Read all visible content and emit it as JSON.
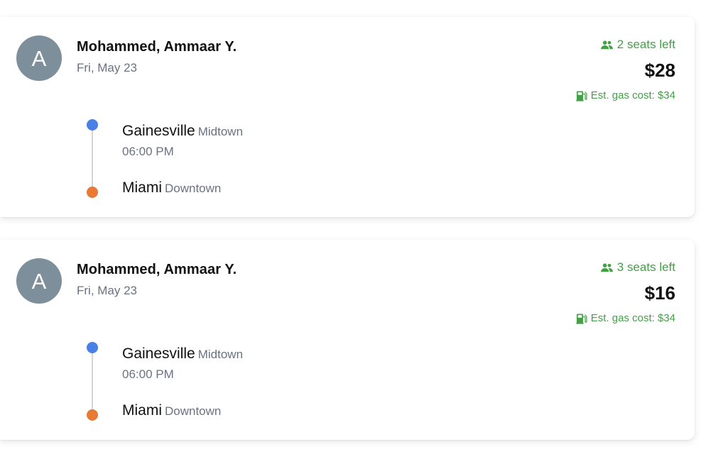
{
  "colors": {
    "accent_green": "#43a047",
    "origin_dot": "#4a7fe6",
    "destination_dot": "#e77b35",
    "avatar_bg": "#7d8f9a"
  },
  "rides": [
    {
      "avatar_initial": "A",
      "driver_name": "Mohammed, Ammaar Y.",
      "date": "Fri, May 23",
      "seats_icon": "people-icon",
      "seats_left": "2 seats left",
      "price": "$28",
      "gas_icon": "gas-pump-icon",
      "gas_cost": "Est. gas cost: $34",
      "origin": {
        "city": "Gainesville",
        "area": "Midtown",
        "time": "06:00 PM"
      },
      "destination": {
        "city": "Miami",
        "area": "Downtown"
      }
    },
    {
      "avatar_initial": "A",
      "driver_name": "Mohammed, Ammaar Y.",
      "date": "Fri, May 23",
      "seats_icon": "people-icon",
      "seats_left": "3 seats left",
      "price": "$16",
      "gas_icon": "gas-pump-icon",
      "gas_cost": "Est. gas cost: $34",
      "origin": {
        "city": "Gainesville",
        "area": "Midtown",
        "time": "06:00 PM"
      },
      "destination": {
        "city": "Miami",
        "area": "Downtown"
      }
    }
  ]
}
